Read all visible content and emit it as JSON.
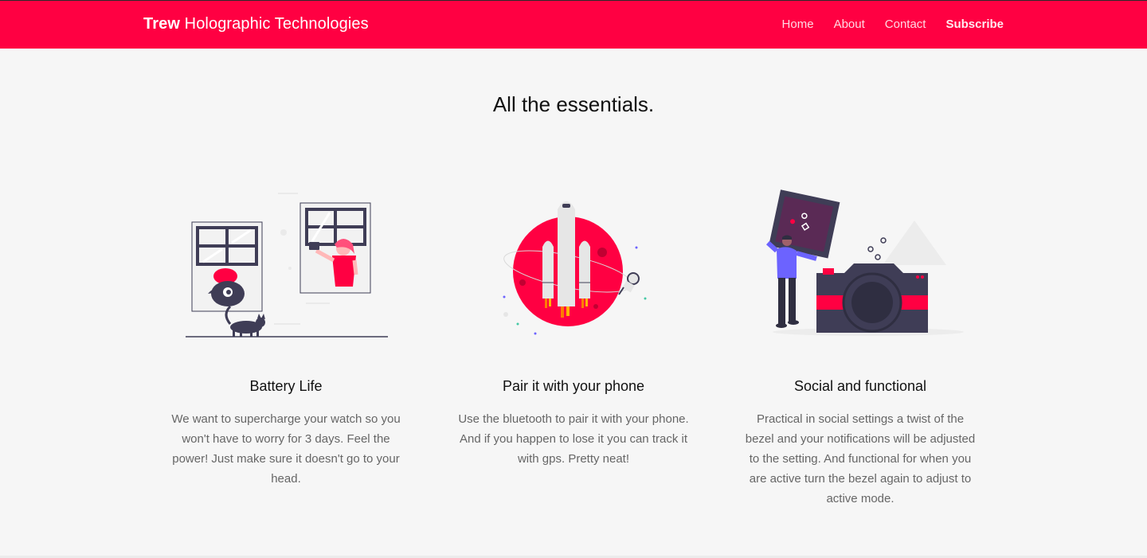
{
  "header": {
    "brand_bold": "Trew",
    "brand_rest": "Holographic Technologies",
    "nav": [
      "Home",
      "About",
      "Contact",
      "Subscribe"
    ]
  },
  "main": {
    "headline": "All the essentials.",
    "features": [
      {
        "title": "Battery Life",
        "text": "We want to supercharge your watch so you won't have to worry for 3 days. Feel the power! Just make sure it doesn't go to your head.",
        "illustration": "windows-cat-illustration"
      },
      {
        "title": "Pair it with your phone",
        "text": "Use the bluetooth to pair it with your phone. And if you happen to lose it you can track it with gps. Pretty neat!",
        "illustration": "rocket-planet-illustration"
      },
      {
        "title": "Social and functional",
        "text": "Practical in social settings a twist of the bezel and your notifications will be adjusted to the setting. And functional for when you are active turn the bezel again to adjust to active mode.",
        "illustration": "camera-photo-illustration"
      }
    ]
  },
  "colors": {
    "accent": "#ff0042",
    "dark": "#3f3d56",
    "purple": "#6c63ff",
    "background": "#f6f6f6"
  }
}
